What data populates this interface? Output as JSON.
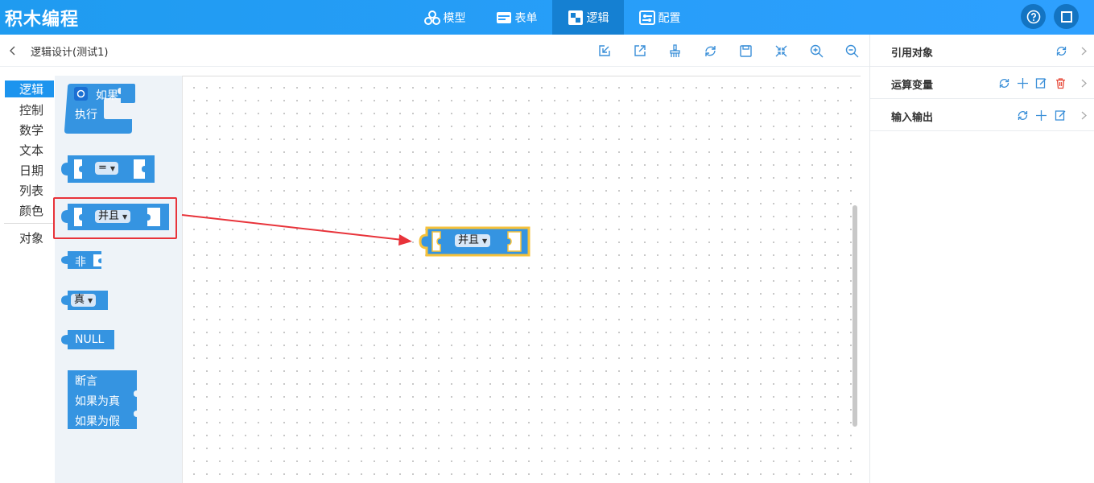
{
  "app": {
    "title": "积木编程"
  },
  "nav": {
    "items": [
      {
        "label": "模型",
        "icon": "model-icon"
      },
      {
        "label": "表单",
        "icon": "form-icon"
      },
      {
        "label": "逻辑",
        "icon": "logic-icon"
      },
      {
        "label": "配置",
        "icon": "config-icon"
      }
    ],
    "active": "逻辑"
  },
  "toolbar": {
    "title": "逻辑设计(测试1)"
  },
  "right_panel": {
    "rows": [
      {
        "label": "引用对象"
      },
      {
        "label": "运算变量"
      },
      {
        "label": "输入输出"
      }
    ]
  },
  "categories": [
    "逻辑",
    "控制",
    "数学",
    "文本",
    "日期",
    "列表",
    "颜色",
    "对象"
  ],
  "blocks": {
    "if_label": "如果",
    "do_label": "执行",
    "compare_op": "=",
    "and_op": "并且",
    "not_label": "非",
    "bool_value": "真",
    "null_label": "NULL",
    "assert_label": "断言",
    "if_true_label": "如果为真",
    "if_false_label": "如果为假"
  },
  "workspace": {
    "placed_block_op": "并且"
  },
  "colors": {
    "header": "#2ea0ff",
    "block": "#3594e1",
    "highlight": "#e8333a",
    "selected": "#f6c23b"
  }
}
